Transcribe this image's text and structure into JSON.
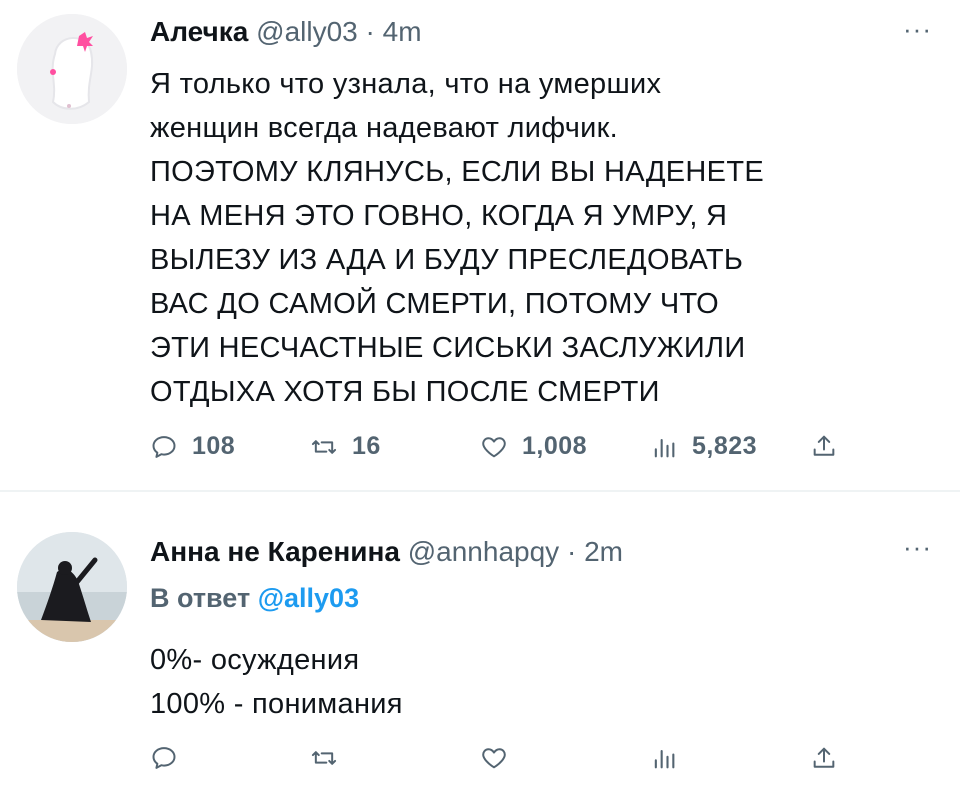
{
  "tweet1": {
    "name": "Алечка",
    "handle": "@ally03",
    "dot": "·",
    "time": "4m",
    "more": "···",
    "lines": [
      "Я только что узнала, что на умерших",
      "женщин всегда надевают лифчик.",
      "ПОЭТОМУ КЛЯНУСЬ, ЕСЛИ ВЫ НАДЕНЕТЕ",
      "НА МЕНЯ ЭТО ГОВНО, КОГДА Я УМРУ, Я",
      "ВЫЛЕЗУ ИЗ АДА И БУДУ ПРЕСЛЕДОВАТЬ",
      "ВАС ДО САМОЙ СМЕРТИ, ПОТОМУ ЧТО",
      "ЭТИ НЕСЧАСТНЫЕ СИСЬКИ ЗАСЛУЖИЛИ",
      "ОТДЫХА ХОТЯ БЫ ПОСЛЕ СМЕРТИ"
    ],
    "actions": {
      "replies": "108",
      "retweets": "16",
      "likes": "1,008",
      "views": "5,823"
    },
    "icons": [
      "reply-icon",
      "retweet-icon",
      "like-icon",
      "views-icon",
      "share-icon"
    ]
  },
  "tweet2": {
    "name": "Анна не Каренина",
    "handle": "@annhapqy",
    "dot": "·",
    "time": "2m",
    "more": "···",
    "reply_label": "В ответ",
    "reply_mention": "@ally03",
    "lines": [
      "0%- осуждения",
      "100% - понимания"
    ],
    "icons": [
      "reply-icon",
      "retweet-icon",
      "like-icon",
      "views-icon",
      "share-icon"
    ]
  },
  "colors": {
    "text": "#0f1419",
    "secondary": "#536471",
    "accent": "#1d9bf0",
    "divider": "#eff3f4"
  }
}
